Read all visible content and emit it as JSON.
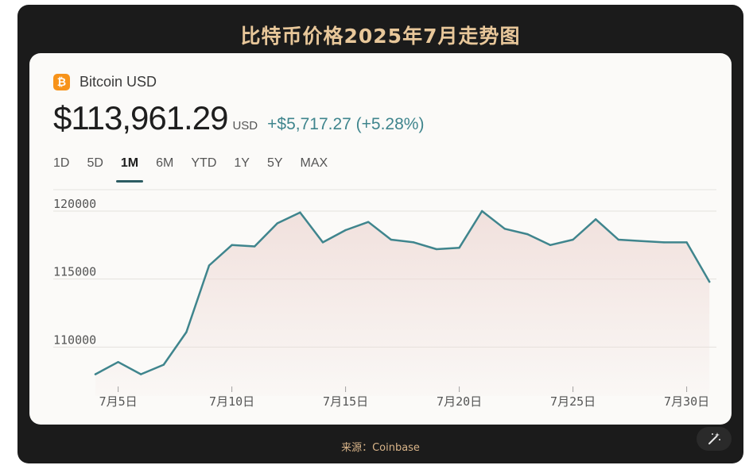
{
  "frame": {
    "title": "比特币价格2025年7月走势图",
    "source": "来源：Coinbase"
  },
  "asset": {
    "icon": "bitcoin-icon",
    "icon_glyph": "₿",
    "name": "Bitcoin USD",
    "price": "$113,961.29",
    "currency": "USD",
    "change": "+$5,717.27 (+5.28%)"
  },
  "ranges": [
    "1D",
    "5D",
    "1M",
    "6M",
    "YTD",
    "1Y",
    "5Y",
    "MAX"
  ],
  "active_range": "1M",
  "colors": {
    "line": "#3f858d",
    "fill": "#efdcd8",
    "title": "#e8c79a",
    "brand": "#f7931a"
  },
  "chart_data": {
    "type": "area",
    "x": [
      "7月4日",
      "7月5日",
      "7月6日",
      "7月7日",
      "7月8日",
      "7月9日",
      "7月10日",
      "7月11日",
      "7月12日",
      "7月13日",
      "7月14日",
      "7月15日",
      "7月16日",
      "7月17日",
      "7月18日",
      "7月19日",
      "7月20日",
      "7月21日",
      "7月22日",
      "7月23日",
      "7月24日",
      "7月25日",
      "7月26日",
      "7月27日",
      "7月28日",
      "7月29日",
      "7月30日",
      "7月31日"
    ],
    "series": [
      {
        "values": [
          108000,
          108900,
          108000,
          108700,
          111100,
          116000,
          117500,
          117400,
          119100,
          119900,
          117700,
          118600,
          119200,
          117900,
          117700,
          117200,
          117300,
          120000,
          118700,
          118300,
          117500,
          117900,
          119400,
          117900,
          117800,
          117700,
          117700,
          114800
        ]
      }
    ],
    "xticks": [
      "7月5日",
      "7月10日",
      "7月15日",
      "7月20日",
      "7月25日",
      "7月30日"
    ],
    "yticks": [
      "120000",
      "115000",
      "110000"
    ],
    "ylim": [
      106400,
      121400
    ],
    "grid": true
  }
}
